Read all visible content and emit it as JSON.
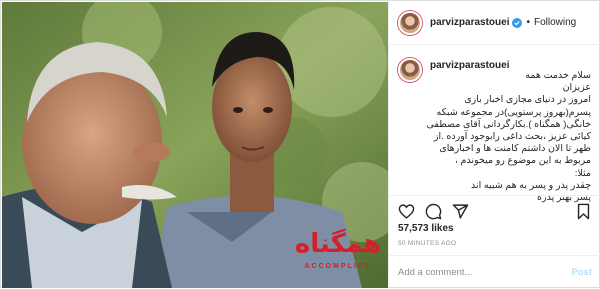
{
  "post": {
    "username": "parvizparastouei",
    "separator": "•",
    "follow_label": "Following",
    "caption_lines": [
      "سلام خدمت همه",
      "عزیزان",
      "امروز در دنیای مجازی اخبار بازی",
      "پسرم(بهروز پرستویی)در مجموعه شبکه",
      "خانگی( همگناه ).بکارگردانی آقای مصطفی",
      "کیائی عزیز ،بحث داغی رابوجود آورده .از",
      "ظهر تا الان داشتم کامنت ها و اخبارهای",
      "مربوط به این موضوع رو میخوندم ،",
      "مثلا:",
      "چقدر پدر و پسر به هم شبیه اند",
      "پسر بهتر پدره"
    ],
    "likes": "57,573 likes",
    "time": "50 MINUTES AGO",
    "comment_placeholder": "Add a comment...",
    "post_label": "Post"
  },
  "image": {
    "logo_text": "همگناه",
    "logo_subtext": "ACCOMPLICE"
  },
  "icons": {
    "verified": "verified-badge-icon",
    "like": "heart-icon",
    "comment": "comment-icon",
    "share": "share-icon",
    "save": "bookmark-icon"
  },
  "colors": {
    "verified": "#3897f0",
    "logo_red": "#d4202a",
    "post_disabled": "#b2dffc",
    "muted": "#8e8e8e"
  }
}
